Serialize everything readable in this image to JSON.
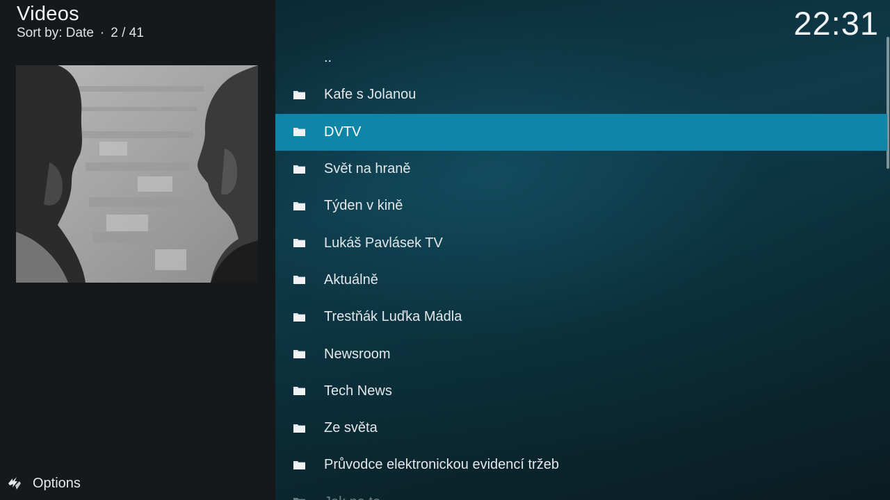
{
  "header": {
    "title": "Videos",
    "sort_label": "Sort by: Date",
    "separator": "·",
    "position": "2 / 41"
  },
  "clock": "22:31",
  "options_label": "Options",
  "list": {
    "items": [
      {
        "label": "..",
        "icon": "none"
      },
      {
        "label": "Kafe s Jolanou",
        "icon": "folder-icon"
      },
      {
        "label": "DVTV",
        "icon": "folder-icon",
        "selected": true
      },
      {
        "label": "Svět na hraně",
        "icon": "folder-icon"
      },
      {
        "label": "Týden v kině",
        "icon": "folder-icon"
      },
      {
        "label": "Lukáš Pavlásek TV",
        "icon": "folder-icon"
      },
      {
        "label": "Aktuálně",
        "icon": "folder-icon"
      },
      {
        "label": "Trestňák Luďka Mádla",
        "icon": "folder-icon"
      },
      {
        "label": "Newsroom",
        "icon": "folder-icon"
      },
      {
        "label": "Tech News",
        "icon": "folder-icon"
      },
      {
        "label": "Ze světa",
        "icon": "folder-icon"
      },
      {
        "label": "Průvodce elektronickou evidencí tržeb",
        "icon": "folder-icon"
      },
      {
        "label": "Jak na to",
        "icon": "folder-icon"
      }
    ]
  },
  "colors": {
    "selected_row": "#0f86a8",
    "left_panel": "#15191b",
    "right_panel": "#0f3a49"
  }
}
